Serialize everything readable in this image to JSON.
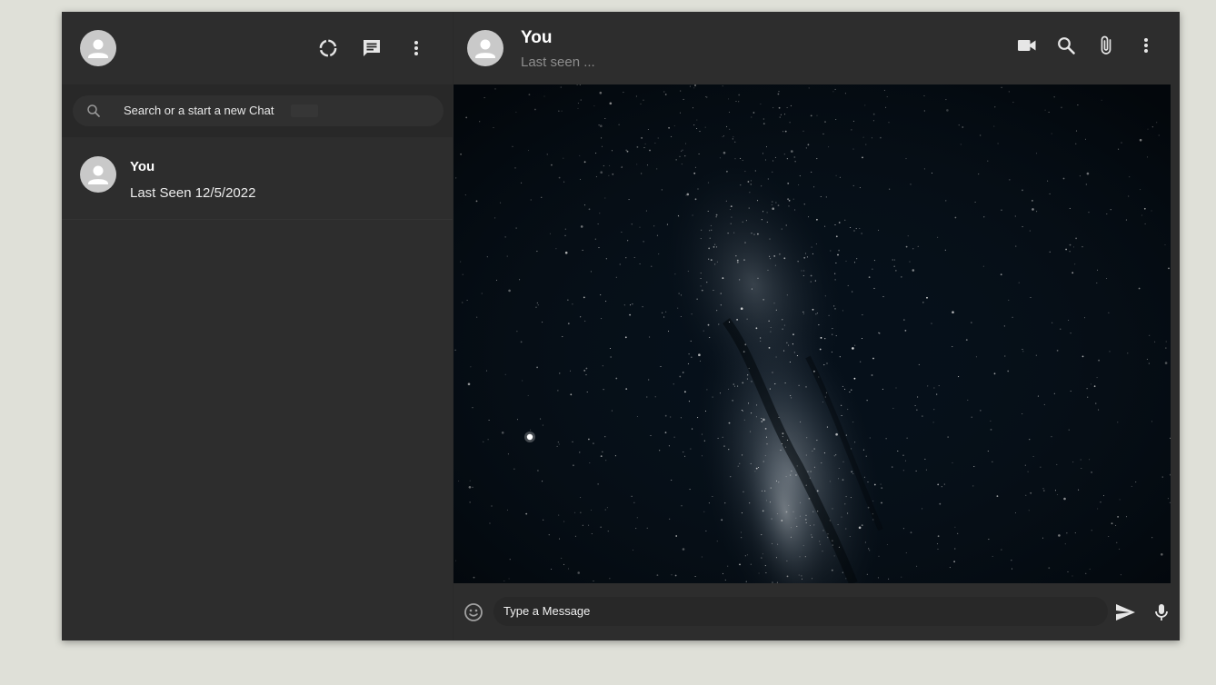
{
  "sidebar": {
    "header": {
      "icons": [
        "avatar-icon",
        "status-icon",
        "new-chat-icon",
        "more-vert-icon"
      ]
    },
    "search": {
      "placeholder": "Search or a start a new Chat"
    },
    "chats": [
      {
        "name": "You",
        "last_seen": "Last Seen 12/5/2022"
      }
    ]
  },
  "chat": {
    "header": {
      "title": "You",
      "subtitle": "Last seen ...",
      "icons": [
        "video-icon",
        "search-icon",
        "attach-icon",
        "more-vert-icon"
      ]
    },
    "background": "milky-way-starfield",
    "footer": {
      "placeholder": "Type a Message",
      "icons": [
        "emoji-icon",
        "send-icon",
        "mic-icon"
      ]
    }
  },
  "colors": {
    "page_bg": "#dfe0d8",
    "panel_bg": "#2d2d2d",
    "input_bg": "#282828",
    "text_primary": "#ffffff",
    "text_muted": "#8d8d8d",
    "icon": "#e6e6e6"
  }
}
